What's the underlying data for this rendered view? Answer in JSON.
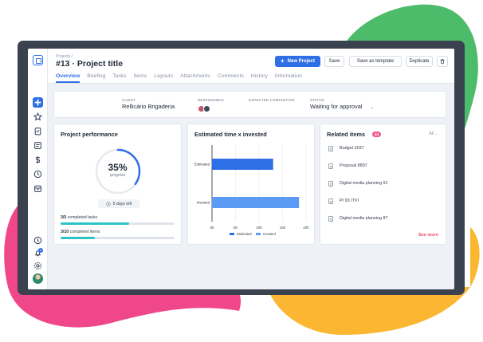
{
  "colors": {
    "accent": "#2f6fe6",
    "accent_light": "#5b9bf5",
    "progress_teal": "#2ec4c6",
    "badge_pink": "#f25b8a",
    "see_more": "#ef4b6e",
    "blob_green": "#4cbc6a",
    "blob_pink": "#f0468a",
    "blob_yellow": "#fbb731"
  },
  "rail": {
    "icons": [
      "logo-icon",
      "add-icon",
      "star-icon",
      "clipboard-icon",
      "checklist-icon",
      "dollar-icon",
      "clock-icon",
      "archive-icon",
      "help-icon",
      "notifications-icon",
      "settings-icon",
      "user-avatar"
    ],
    "notification_count": "4"
  },
  "header": {
    "breadcrumb": "Projects /",
    "title": "#13 · Project title",
    "new_project_label": "New Project",
    "save_label": "Save",
    "save_template_label": "Save as template",
    "duplicate_label": "Duplicate",
    "tabs": [
      {
        "label": "Overview",
        "active": true
      },
      {
        "label": "Briefing"
      },
      {
        "label": "Tasks"
      },
      {
        "label": "Items"
      },
      {
        "label": "Layouts"
      },
      {
        "label": "Attachments"
      },
      {
        "label": "Comments"
      },
      {
        "label": "History"
      },
      {
        "label": "Information"
      }
    ]
  },
  "details": {
    "client_label": "CLIENT",
    "client_value": "Rellicário Brigaderia",
    "responsible_label": "RESPONSIBLE",
    "expected_label": "EXPECTED COMPLETION",
    "status_label": "STATUS",
    "status_value": "Waiting for approval"
  },
  "performance": {
    "title": "Project performance",
    "percent_text": "35%",
    "percent_value": 35,
    "percent_caption": "progress",
    "days_left": "5 days left",
    "tasks_count": "3/5",
    "tasks_label": "completed tasks",
    "tasks_fraction": 0.6,
    "items_count": "3/10",
    "items_label": "completed items",
    "items_fraction": 0.3
  },
  "chart_data": {
    "type": "bar",
    "orientation": "horizontal",
    "title": "Estimated time x invested",
    "categories": [
      "Estimated",
      "Invested"
    ],
    "values": [
      13,
      18.5
    ],
    "series": [
      {
        "name": "Estimated",
        "color": "#2f6fe6"
      },
      {
        "name": "Invested",
        "color": "#5b9bf5"
      }
    ],
    "xticks": [
      "0h",
      "5h",
      "10h",
      "15h",
      "20h"
    ],
    "xlim": [
      0,
      20
    ],
    "grid": true,
    "legend": "bottom"
  },
  "related": {
    "title": "Related items",
    "count": "44",
    "filter": "All",
    "items": [
      "Budget 2037",
      "Proposal 8897",
      "Digital media planning 91",
      "PI 93 ITVI",
      "Digital media planning 87"
    ],
    "see_more": "See more"
  }
}
